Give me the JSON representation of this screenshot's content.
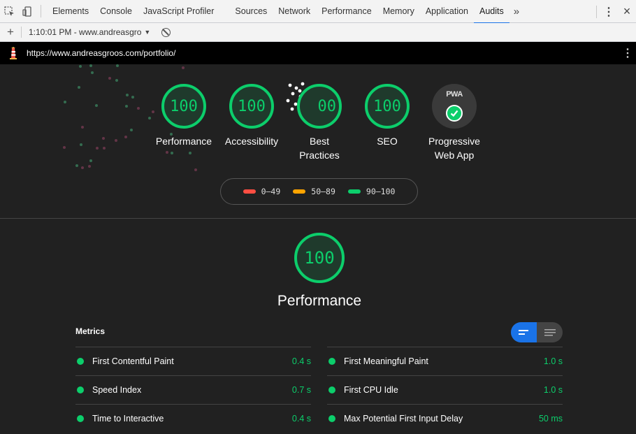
{
  "devtools": {
    "tabs": [
      {
        "label": "Elements"
      },
      {
        "label": "Console"
      },
      {
        "label": "JavaScript Profiler"
      },
      {
        "label": "Sources"
      },
      {
        "label": "Network"
      },
      {
        "label": "Performance"
      },
      {
        "label": "Memory"
      },
      {
        "label": "Application"
      },
      {
        "label": "Audits",
        "active": true
      }
    ],
    "more_tabs": "»"
  },
  "toolbar": {
    "report_time": "1:10:01 PM - www.andreasgro"
  },
  "report": {
    "url": "https://www.andreasgroos.com/portfolio/",
    "gauges": [
      {
        "label": "Performance",
        "score": "100"
      },
      {
        "label": "Accessibility",
        "score": "100"
      },
      {
        "label": "Best Practices",
        "score": "00"
      },
      {
        "label": "SEO",
        "score": "100"
      },
      {
        "label": "Progressive Web App",
        "badge": "PWA"
      }
    ],
    "legend": [
      {
        "label": "0–49",
        "color": "#ff4e42"
      },
      {
        "label": "50–89",
        "color": "#ffa400"
      },
      {
        "label": "90–100",
        "color": "#0cce6b"
      }
    ],
    "category": {
      "title": "Performance",
      "score": "100"
    },
    "metrics_title": "Metrics",
    "metrics_left": [
      {
        "name": "First Contentful Paint",
        "value": "0.4 s"
      },
      {
        "name": "Speed Index",
        "value": "0.7 s"
      },
      {
        "name": "Time to Interactive",
        "value": "0.4 s"
      }
    ],
    "metrics_right": [
      {
        "name": "First Meaningful Paint",
        "value": "1.0 s"
      },
      {
        "name": "First CPU Idle",
        "value": "1.0 s"
      },
      {
        "name": "Max Potential First Input Delay",
        "value": "50 ms"
      }
    ],
    "colors": {
      "pass": "#0cce6b",
      "accent": "#1a73e8"
    }
  }
}
